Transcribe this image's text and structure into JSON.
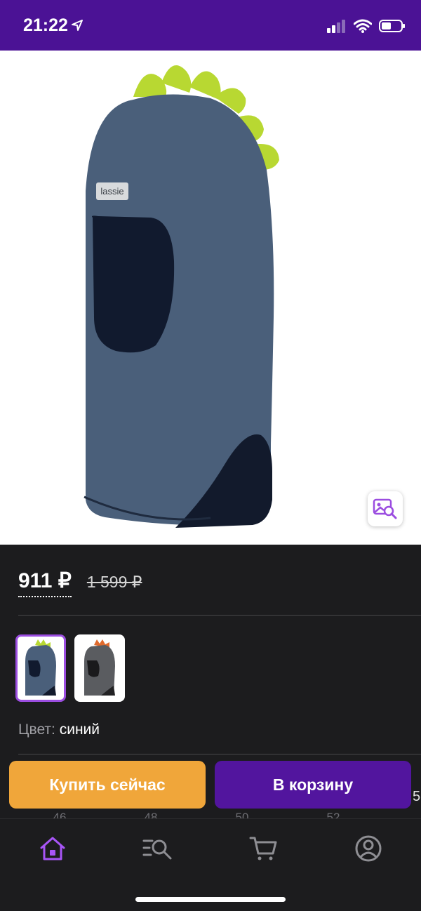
{
  "status": {
    "time": "21:22"
  },
  "product": {
    "image_alt": "lassie",
    "price_current": "911 ₽",
    "price_old": "1 599 ₽",
    "color_label": "Цвет:",
    "color_value": "синий",
    "brand_tag": "lassie"
  },
  "actions": {
    "buy_now": "Купить сейчас",
    "add_to_cart": "В корзину"
  },
  "sizes": [
    "46",
    "48",
    "50",
    "52",
    "5"
  ],
  "edge_digit": "5",
  "tabs": [
    "home-icon",
    "catalog-search-icon",
    "cart-icon",
    "profile-icon"
  ],
  "colors": {
    "brand": "#4b1295",
    "accent_orange": "#f0a63a",
    "accent_purple": "#52159e",
    "tab_active": "#a855f7"
  }
}
